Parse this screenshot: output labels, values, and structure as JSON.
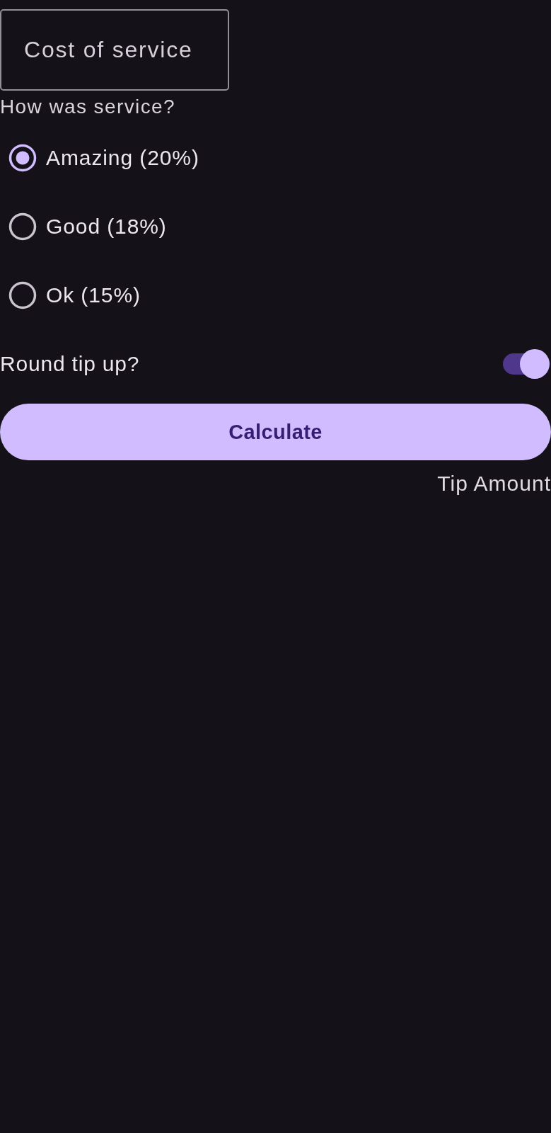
{
  "cost_field": {
    "placeholder": "Cost of service"
  },
  "service_question": "How was service?",
  "service_options": [
    {
      "label": "Amazing (20%)",
      "selected": true
    },
    {
      "label": "Good (18%)",
      "selected": false
    },
    {
      "label": "Ok (15%)",
      "selected": false
    }
  ],
  "round_up": {
    "label": "Round tip up?",
    "on": true
  },
  "calculate_button": {
    "label": "Calculate"
  },
  "tip_amount": "Tip Amount"
}
